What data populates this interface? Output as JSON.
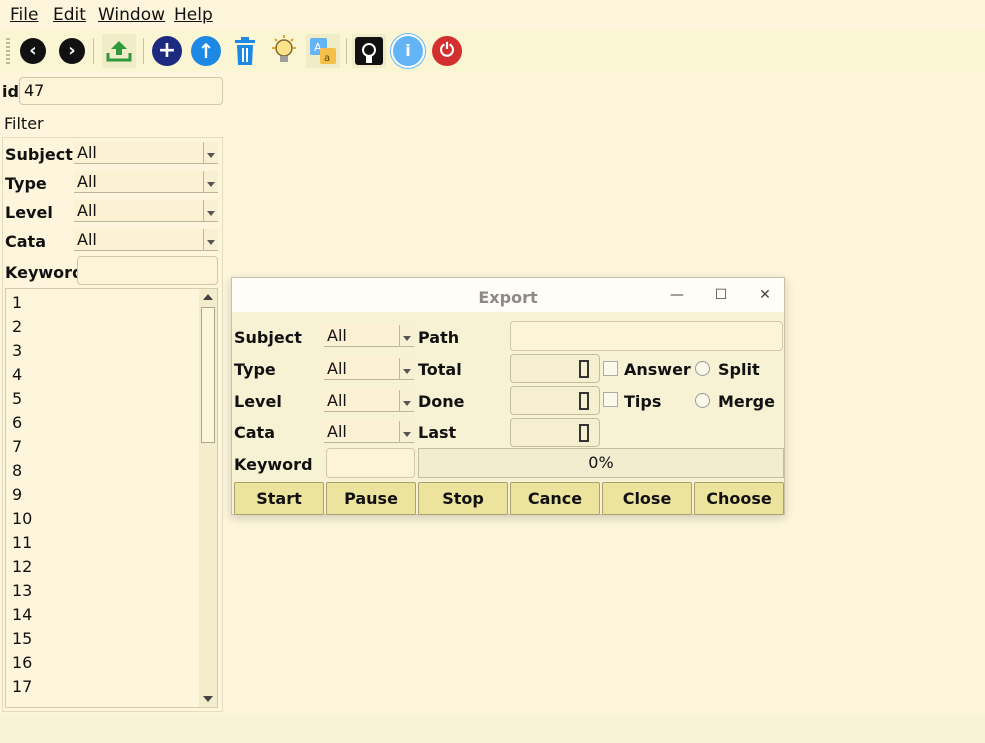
{
  "menu": {
    "file": "File",
    "edit": "Edit",
    "window": "Window",
    "help": "Help"
  },
  "toolbar": {
    "icons": [
      "back-icon",
      "forward-icon",
      "upload-icon",
      "add-icon",
      "up-arrow-icon",
      "trash-icon",
      "lightbulb-icon",
      "translate-icon",
      "github-icon",
      "info-icon",
      "power-icon"
    ],
    "colors": {
      "dark": "#111111",
      "green": "#2f9a3a",
      "navy": "#1c2a80",
      "blue": "#1e88e5",
      "red": "#d32f2f"
    }
  },
  "left": {
    "id_label": "id",
    "id_value": "47",
    "filter_label": "Filter",
    "subject_label": "Subject",
    "subject_value": "All",
    "type_label": "Type",
    "type_value": "All",
    "level_label": "Level",
    "level_value": "All",
    "cata_label": "Cata",
    "cata_value": "All",
    "keyword_label": "Keyword",
    "keyword_value": "",
    "items": [
      "1",
      "2",
      "3",
      "4",
      "5",
      "6",
      "7",
      "8",
      "9",
      "10",
      "11",
      "12",
      "13",
      "14",
      "15",
      "16",
      "17"
    ]
  },
  "dialog": {
    "title": "Export",
    "subject_label": "Subject",
    "subject_value": "All",
    "type_label": "Type",
    "type_value": "All",
    "level_label": "Level",
    "level_value": "All",
    "cata_label": "Cata",
    "cata_value": "All",
    "keyword_label": "Keyword",
    "keyword_value": "",
    "path_label": "Path",
    "path_value": "",
    "total_label": "Total",
    "done_label": "Done",
    "last_label": "Last",
    "answer_label": "Answer",
    "tips_label": "Tips",
    "split_label": "Split",
    "merge_label": "Merge",
    "progress_text": "0%",
    "progress_value": 0,
    "buttons": {
      "start": "Start",
      "pause": "Pause",
      "stop": "Stop",
      "cancel": "Cance",
      "close": "Close",
      "choose": "Choose"
    }
  }
}
